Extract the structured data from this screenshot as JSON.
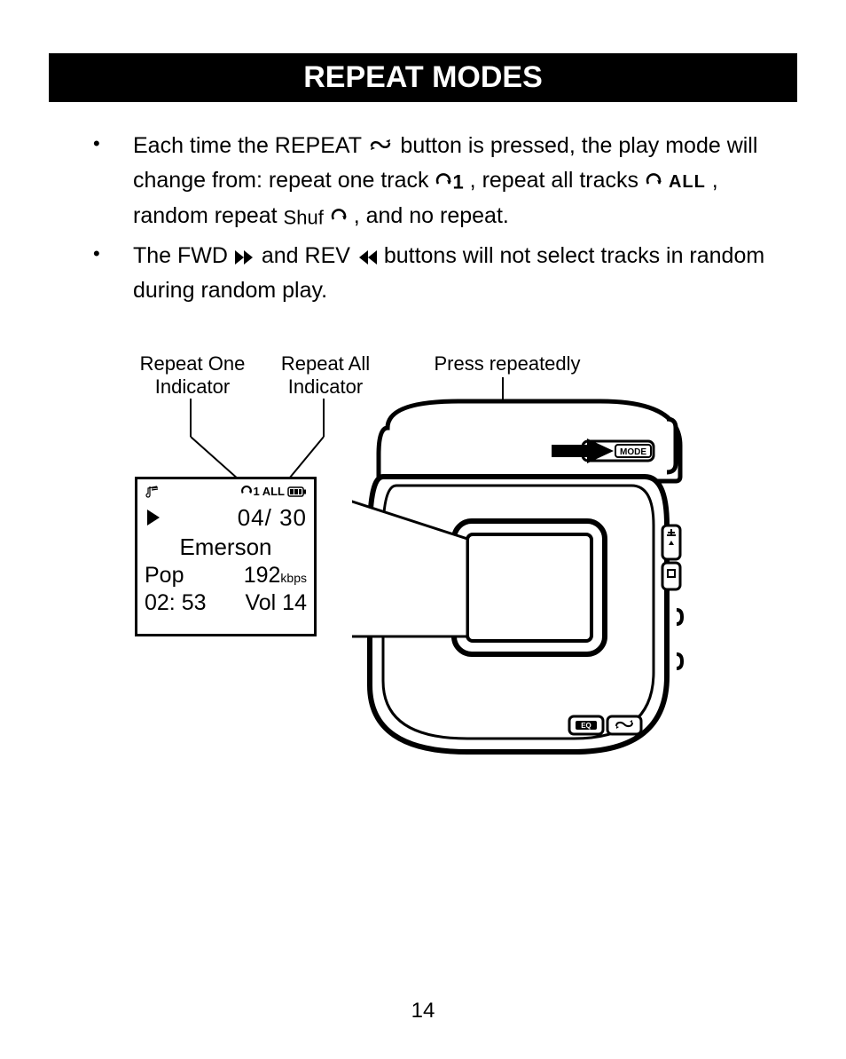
{
  "title": "REPEAT MODES",
  "bullets": [
    {
      "t1": "Each time the REPEAT ",
      "t2": " button is pressed, the play mode will change from: repeat one track ",
      "t3": ", repeat all tracks ",
      "t4": " , random repeat ",
      "t5": ", and no repeat.",
      "repeat_one_suffix": "1",
      "repeat_all_suffix": "ALL",
      "shuffle_prefix": "Shuf"
    },
    {
      "t1": "The FWD ",
      "t2": " and REV ",
      "t3": " buttons will not select tracks in random during random play."
    }
  ],
  "figure": {
    "labels": {
      "repeat_one": "Repeat One Indicator",
      "repeat_all": "Repeat All Indicator",
      "press": "Press repeatedly"
    },
    "lcd": {
      "repeat_one_suffix": "1",
      "repeat_all_text": "ALL",
      "track": "04/ 30",
      "title": "Emerson",
      "genre": "Pop",
      "bitrate_num": "192",
      "bitrate_unit": "kbps",
      "time": "02: 53",
      "volume": "Vol 14"
    },
    "device": {
      "mode_label": "MODE",
      "eq_label": "EQ"
    }
  },
  "page_number": "14"
}
